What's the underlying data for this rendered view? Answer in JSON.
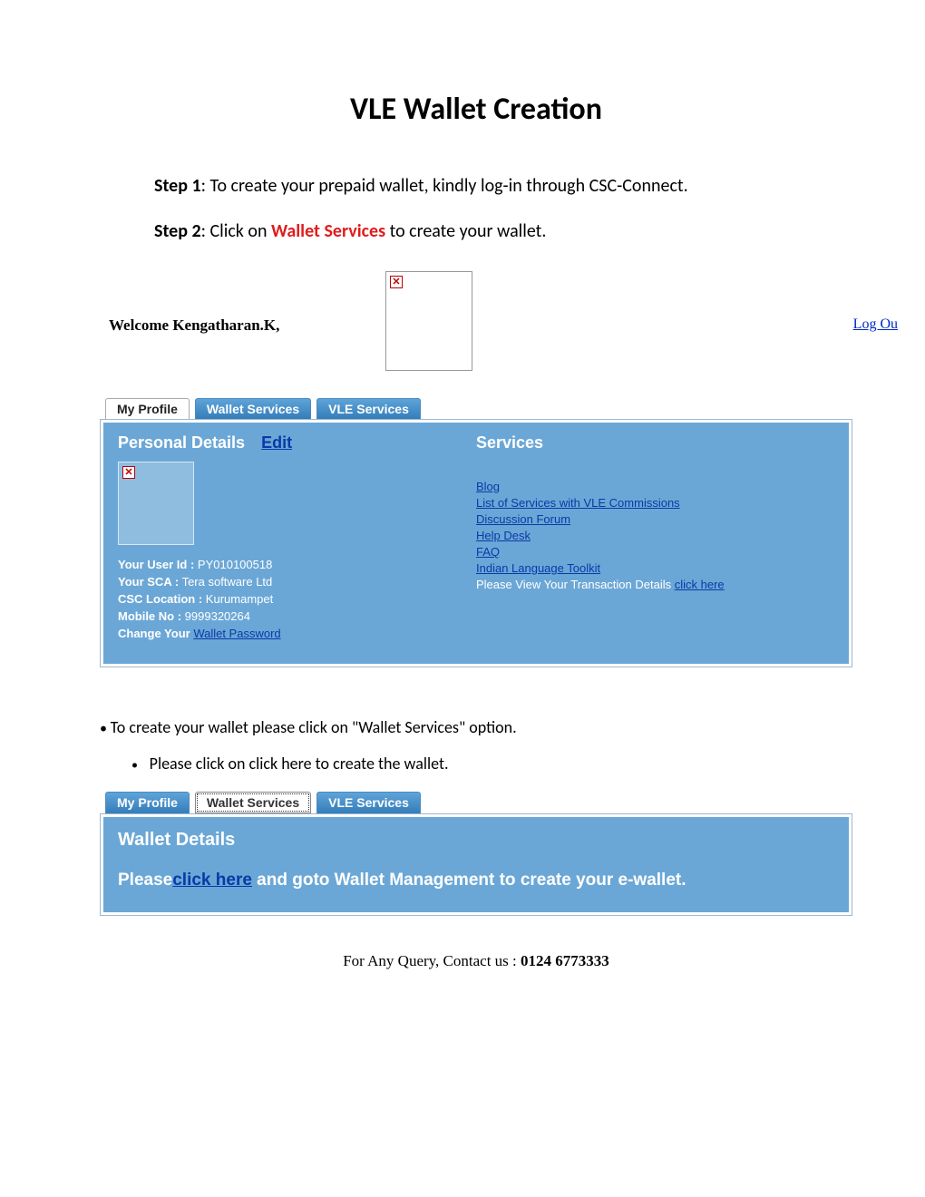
{
  "title": "VLE Wallet Creation",
  "steps": {
    "s1_label": "Step 1",
    "s1_text": ": To create your prepaid wallet, kindly log-in through CSC-Connect.",
    "s2_label": "Step 2",
    "s2_text_a": ": Click on ",
    "s2_text_link": "Wallet Services",
    "s2_text_b": " to create your wallet."
  },
  "header": {
    "welcome": "Welcome Kengatharan.K,",
    "logout": "Log Ou"
  },
  "tabs1": {
    "my_profile": "My Profile",
    "wallet_services": "Wallet Services",
    "vle_services": "VLE Services"
  },
  "profile_panel": {
    "heading": "Personal Details",
    "edit": "Edit",
    "user_id_k": "Your User Id :",
    "user_id_v": "PY010100518",
    "sca_k": "Your SCA :",
    "sca_v": "Tera software Ltd",
    "loc_k": "CSC Location :",
    "loc_v": "Kurumampet",
    "mobile_k": "Mobile No :",
    "mobile_v": "9999320264",
    "change_k": "Change Your ",
    "change_link": "Wallet Password"
  },
  "services_panel": {
    "heading": "Services",
    "links": {
      "l1": "Blog",
      "l2": "List of Services with VLE Commissions",
      "l3": "Discussion Forum",
      "l4": "Help Desk",
      "l5": "FAQ",
      "l6": "Indian Language Toolkit"
    },
    "trans_text": "Please View Your Transaction Details ",
    "trans_link": "click here"
  },
  "bullets": {
    "b1": "To create your wallet please click on \"Wallet Services\" option.",
    "b2": "Please click on click here to create the wallet."
  },
  "tabs2": {
    "my_profile": "My Profile",
    "wallet_services": "Wallet Services",
    "vle_services": "VLE Services"
  },
  "wallet_panel": {
    "heading": "Wallet Details",
    "pre": "Please",
    "link": "click here",
    "post": " and goto Wallet Management to create your e-wallet."
  },
  "footer": {
    "text": "For Any Query, Contact us : ",
    "number": "0124 6773333"
  }
}
